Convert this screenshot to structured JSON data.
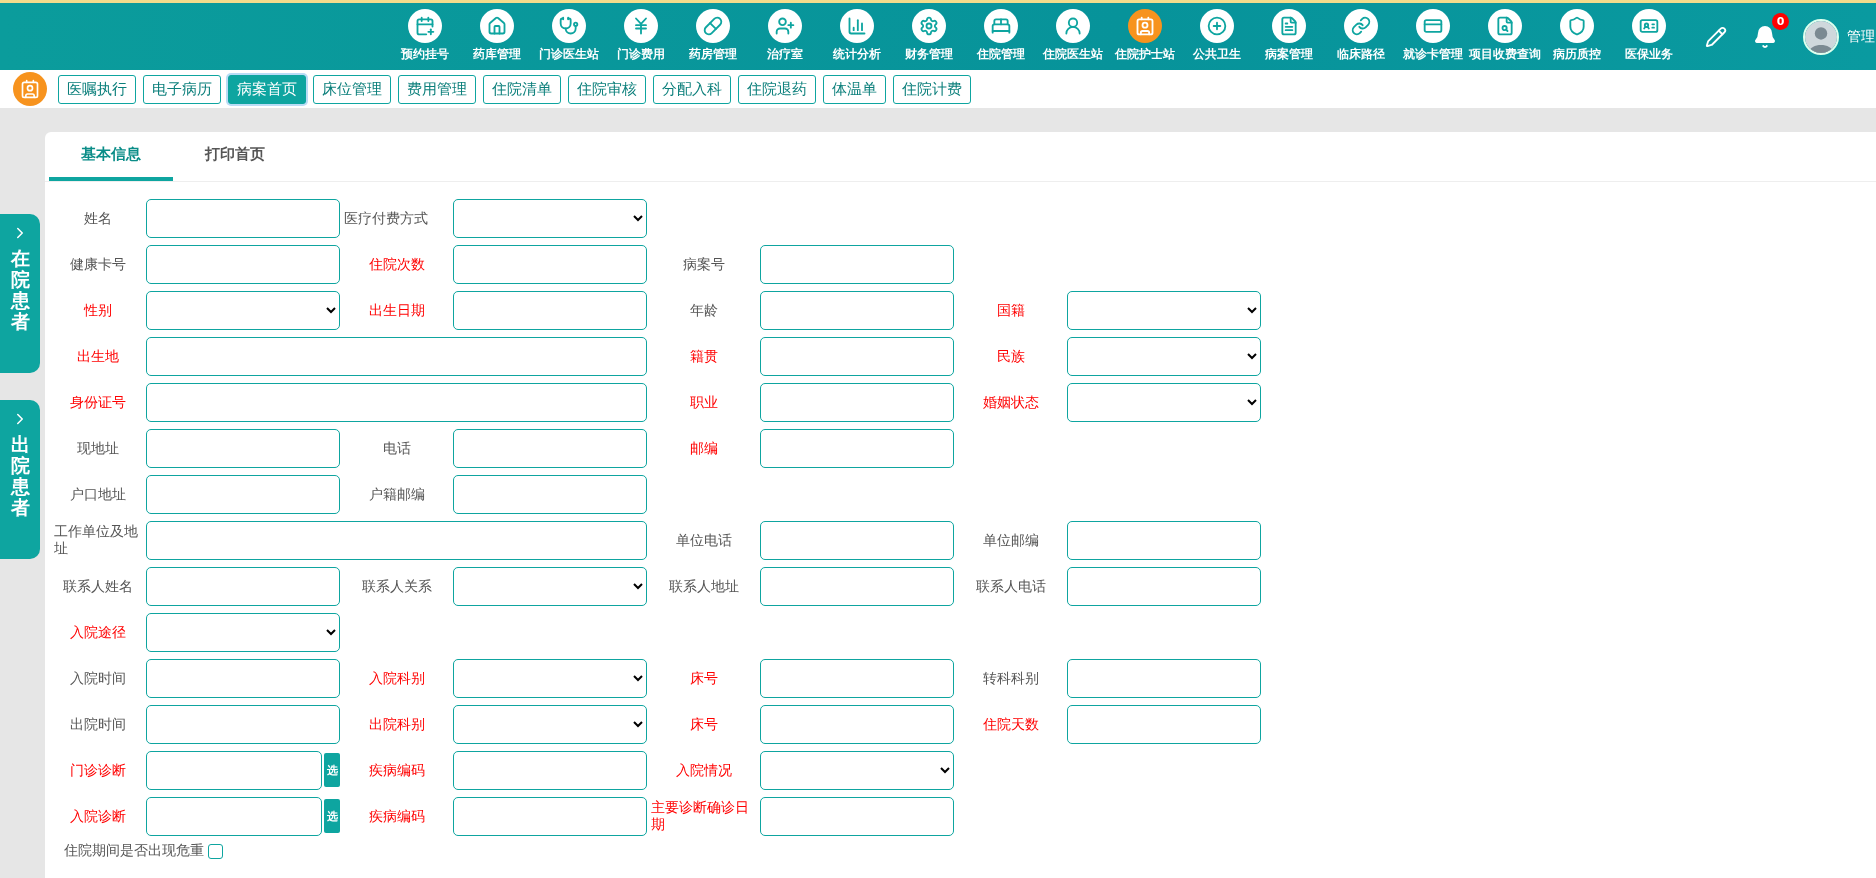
{
  "top_nav": {
    "items": [
      {
        "label": "预约挂号",
        "selected": false
      },
      {
        "label": "药库管理",
        "selected": false
      },
      {
        "label": "门诊医生站",
        "selected": false
      },
      {
        "label": "门诊费用",
        "selected": false
      },
      {
        "label": "药房管理",
        "selected": false
      },
      {
        "label": "治疗室",
        "selected": false
      },
      {
        "label": "统计分析",
        "selected": false
      },
      {
        "label": "财务管理",
        "selected": false
      },
      {
        "label": "住院管理",
        "selected": false
      },
      {
        "label": "住院医生站",
        "selected": false
      },
      {
        "label": "住院护士站",
        "selected": true
      },
      {
        "label": "公共卫生",
        "selected": false
      },
      {
        "label": "病案管理",
        "selected": false
      },
      {
        "label": "临床路径",
        "selected": false
      },
      {
        "label": "就诊卡管理",
        "selected": false
      },
      {
        "label": "项目收费查询",
        "selected": false
      },
      {
        "label": "病历质控",
        "selected": false
      },
      {
        "label": "医保业务",
        "selected": false
      }
    ],
    "notification_count": "0",
    "user_name": "管理"
  },
  "sub_nav": [
    {
      "label": "医嘱执行",
      "selected": false
    },
    {
      "label": "电子病历",
      "selected": false
    },
    {
      "label": "病案首页",
      "selected": true
    },
    {
      "label": "床位管理",
      "selected": false
    },
    {
      "label": "费用管理",
      "selected": false
    },
    {
      "label": "住院清单",
      "selected": false
    },
    {
      "label": "住院审核",
      "selected": false
    },
    {
      "label": "分配入科",
      "selected": false
    },
    {
      "label": "住院退药",
      "selected": false
    },
    {
      "label": "体温单",
      "selected": false
    },
    {
      "label": "住院计费",
      "selected": false
    }
  ],
  "side_tabs": [
    {
      "label": "在院患者"
    },
    {
      "label": "出院患者"
    }
  ],
  "tabs": [
    {
      "label": "基本信息",
      "selected": true
    },
    {
      "label": "打印首页",
      "selected": false
    }
  ],
  "form_rows": [
    [
      {
        "label": "姓名",
        "required": false,
        "kind": "input"
      },
      {
        "label": "医疗付费方式",
        "required": false,
        "kind": "select"
      }
    ],
    [
      {
        "label": "健康卡号",
        "required": false,
        "kind": "input"
      },
      {
        "label": "住院次数",
        "required": true,
        "kind": "input"
      },
      {
        "label": "病案号",
        "required": false,
        "kind": "input"
      }
    ],
    [
      {
        "label": "性别",
        "required": true,
        "kind": "select"
      },
      {
        "label": "出生日期",
        "required": true,
        "kind": "input"
      },
      {
        "label": "年龄",
        "required": false,
        "kind": "input"
      },
      {
        "label": "国籍",
        "required": true,
        "kind": "select"
      }
    ],
    [
      {
        "label": "出生地",
        "required": true,
        "kind": "wide"
      },
      {
        "label": "籍贯",
        "required": true,
        "kind": "input"
      },
      {
        "label": "民族",
        "required": true,
        "kind": "select"
      }
    ],
    [
      {
        "label": "身份证号",
        "required": true,
        "kind": "wide"
      },
      {
        "label": "职业",
        "required": true,
        "kind": "input"
      },
      {
        "label": "婚姻状态",
        "required": true,
        "kind": "select"
      }
    ],
    [
      {
        "label": "现地址",
        "required": false,
        "kind": "input"
      },
      {
        "label": "电话",
        "required": false,
        "kind": "input"
      },
      {
        "label": "邮编",
        "required": true,
        "kind": "input"
      }
    ],
    [
      {
        "label": "户口地址",
        "required": false,
        "kind": "input"
      },
      {
        "label": "户籍邮编",
        "required": false,
        "kind": "input"
      }
    ],
    [
      {
        "label": "工作单位及地址",
        "required": false,
        "kind": "wide"
      },
      {
        "label": "单位电话",
        "required": false,
        "kind": "input"
      },
      {
        "label": "单位邮编",
        "required": false,
        "kind": "input"
      }
    ],
    [
      {
        "label": "联系人姓名",
        "required": false,
        "kind": "input"
      },
      {
        "label": "联系人关系",
        "required": false,
        "kind": "select"
      },
      {
        "label": "联系人地址",
        "required": false,
        "kind": "input"
      },
      {
        "label": "联系人电话",
        "required": false,
        "kind": "input"
      }
    ],
    [
      {
        "label": "入院途径",
        "required": true,
        "kind": "select"
      }
    ],
    [
      {
        "label": "入院时间",
        "required": false,
        "kind": "input"
      },
      {
        "label": "入院科别",
        "required": true,
        "kind": "select"
      },
      {
        "label": "床号",
        "required": true,
        "kind": "input"
      },
      {
        "label": "转科科别",
        "required": false,
        "kind": "input"
      }
    ],
    [
      {
        "label": "出院时间",
        "required": false,
        "kind": "input"
      },
      {
        "label": "出院科别",
        "required": true,
        "kind": "select"
      },
      {
        "label": "床号",
        "required": true,
        "kind": "input"
      },
      {
        "label": "住院天数",
        "required": true,
        "kind": "input"
      }
    ],
    [
      {
        "label": "门诊诊断",
        "required": true,
        "kind": "pick",
        "button": "选"
      },
      {
        "label": "疾病编码",
        "required": true,
        "kind": "input"
      },
      {
        "label": "入院情况",
        "required": true,
        "kind": "select"
      }
    ],
    [
      {
        "label": "入院诊断",
        "required": true,
        "kind": "pick",
        "button": "选"
      },
      {
        "label": "疾病编码",
        "required": true,
        "kind": "input"
      },
      {
        "label": "主要诊断确诊日期",
        "required": true,
        "kind": "input"
      }
    ]
  ],
  "critical_check": {
    "label": "住院期间是否出现危重",
    "checked": false
  }
}
